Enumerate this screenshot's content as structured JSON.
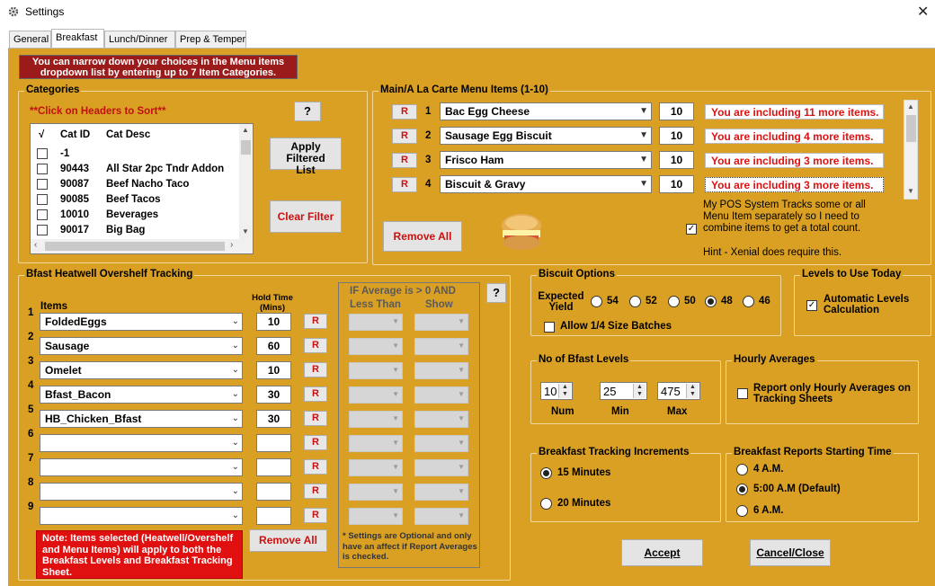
{
  "window": {
    "title": "Settings",
    "close": "✕"
  },
  "tabs": [
    "General",
    "Breakfast",
    "Lunch/Dinner",
    "Prep & Temper"
  ],
  "notice": "You can narrow down your choices in the Menu items dropdown list by entering up to 7 Item Categories.",
  "categories": {
    "title": "Categories",
    "hint": "**Click on Headers to Sort**",
    "help": "?",
    "headers": {
      "check": "√",
      "id": "Cat ID",
      "desc": "Cat Desc"
    },
    "rows": [
      {
        "id": "-1",
        "desc": ""
      },
      {
        "id": "90443",
        "desc": "All Star 2pc Tndr Addon"
      },
      {
        "id": "90087",
        "desc": "Beef Nacho Taco"
      },
      {
        "id": "90085",
        "desc": "Beef Tacos"
      },
      {
        "id": "10010",
        "desc": "Beverages"
      },
      {
        "id": "90017",
        "desc": "Big Bag"
      }
    ],
    "apply_label": "Apply Filtered List",
    "clear_label": "Clear Filter"
  },
  "menu": {
    "title": "Main/A La Carte Menu Items (1-10)",
    "items": [
      {
        "n": "1",
        "name": "Bac Egg Cheese",
        "qty": "10",
        "msg": "You are including 11 more items."
      },
      {
        "n": "2",
        "name": "Sausage Egg Biscuit",
        "qty": "10",
        "msg": "You are including 4 more items."
      },
      {
        "n": "3",
        "name": "Frisco Ham",
        "qty": "10",
        "msg": "You are including 3 more items."
      },
      {
        "n": "4",
        "name": "Biscuit & Gravy",
        "qty": "10",
        "msg": "You are including 3 more items."
      }
    ],
    "r_label": "R",
    "remove_all": "Remove All",
    "pos_text": "My POS System Tracks some or all Menu Item separately so I need to combine items to get a total count.",
    "hint": "Hint - Xenial does require this."
  },
  "heatwell": {
    "title": "Bfast Heatwell Overshelf Tracking",
    "items_header": "Items",
    "hold_header": "Hold Time (Mins)",
    "avg_title": "IF Average is > 0 AND",
    "less_than": "Less Than",
    "show": "Show",
    "help": "?",
    "rows": [
      {
        "n": "1",
        "item": "FoldedEggs",
        "hold": "10"
      },
      {
        "n": "2",
        "item": "Sausage",
        "hold": "60"
      },
      {
        "n": "3",
        "item": "Omelet",
        "hold": "10"
      },
      {
        "n": "4",
        "item": "Bfast_Bacon",
        "hold": "30"
      },
      {
        "n": "5",
        "item": "HB_Chicken_Bfast",
        "hold": "30"
      },
      {
        "n": "6",
        "item": "",
        "hold": ""
      },
      {
        "n": "7",
        "item": "",
        "hold": ""
      },
      {
        "n": "8",
        "item": "",
        "hold": ""
      },
      {
        "n": "9",
        "item": "",
        "hold": ""
      }
    ],
    "remove_all": "Remove All",
    "note": "Note:  Items selected (Heatwell/Overshelf and Menu Items) will apply to both the Breakfast Levels and Breakfast Tracking Sheet.",
    "settings_note": "* Settings are Optional and only have an affect if Report Averages is checked."
  },
  "biscuit": {
    "title": "Biscuit Options",
    "yield_label": "Expected Yield",
    "options": [
      "54",
      "52",
      "50",
      "48",
      "46"
    ],
    "selected": "48",
    "quarter": "Allow 1/4 Size Batches"
  },
  "levels_today": {
    "title": "Levels to Use Today",
    "auto": "Automatic Levels Calculation"
  },
  "num_levels": {
    "title": "No of Bfast Levels",
    "num": "10",
    "min": "25",
    "max": "475",
    "num_label": "Num",
    "min_label": "Min",
    "max_label": "Max"
  },
  "hourly": {
    "title": "Hourly Averages",
    "label": "Report only Hourly Averages on Tracking Sheets"
  },
  "increments": {
    "title": "Breakfast Tracking Increments",
    "opt1": "15 Minutes",
    "opt2": "20 Minutes",
    "selected": "15 Minutes"
  },
  "reports": {
    "title": "Breakfast Reports Starting Time",
    "opts": [
      "4 A.M.",
      "5:00 A.M (Default)",
      "6 A.M."
    ],
    "selected": "5:00 A.M (Default)"
  },
  "footer": {
    "accept": "Accept",
    "cancel": "Cancel/Close"
  }
}
